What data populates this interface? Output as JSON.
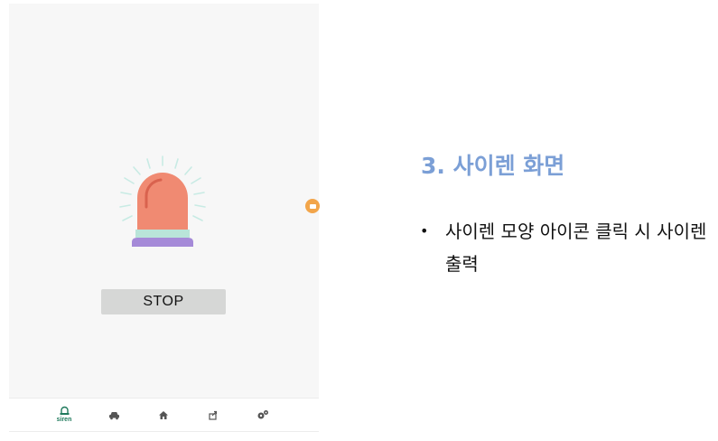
{
  "app": {
    "stop_label": "STOP",
    "nav": [
      {
        "icon": "siren-icon",
        "label": "siren",
        "active": true
      },
      {
        "icon": "car-icon",
        "label": ""
      },
      {
        "icon": "home-icon",
        "label": ""
      },
      {
        "icon": "share-icon",
        "label": ""
      },
      {
        "icon": "settings-icon",
        "label": ""
      }
    ],
    "colors": {
      "siren_body": "#f08a72",
      "siren_band": "#b9e4d9",
      "siren_base": "#a58ad8",
      "rays": "#c8ebe4",
      "nav_active": "#1f7a5c"
    }
  },
  "slide": {
    "title": "3. 사이렌 화면",
    "bullet": "사이렌 모양 아이콘 클릭 시 사이렌 출력"
  }
}
